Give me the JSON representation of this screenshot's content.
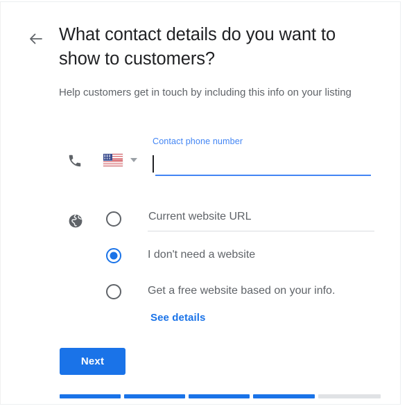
{
  "header": {
    "back_icon": "arrow-left-icon",
    "title": "What contact details do you want to show to customers?",
    "subtitle": "Help customers get in touch by including this info on your listing"
  },
  "phone": {
    "icon": "phone-icon",
    "country_flag": "us-flag-icon",
    "country_caret": "chevron-down-icon",
    "label": "Contact phone number",
    "value": "",
    "placeholder": "",
    "focused": true,
    "accent_color": "#4285f4",
    "label_color": "#4285f4"
  },
  "website": {
    "icon": "globe-icon",
    "options": [
      {
        "id": "current-website-url",
        "label": "Current website URL",
        "is_input": true,
        "value": "",
        "placeholder": "Current website URL",
        "selected": false
      },
      {
        "id": "no-website",
        "label": "I don't need a website",
        "is_input": false,
        "selected": true
      },
      {
        "id": "free-website",
        "label": "Get a free website based on your info.",
        "is_input": false,
        "selected": false
      }
    ],
    "see_details_label": "See details",
    "link_color": "#1a73e8"
  },
  "footer": {
    "next_label": "Next",
    "next_color": "#1a73e8",
    "progress": {
      "total_steps": 5,
      "completed_steps": 4,
      "done_color": "#1a73e8",
      "todo_color": "#e0e2e5"
    }
  }
}
